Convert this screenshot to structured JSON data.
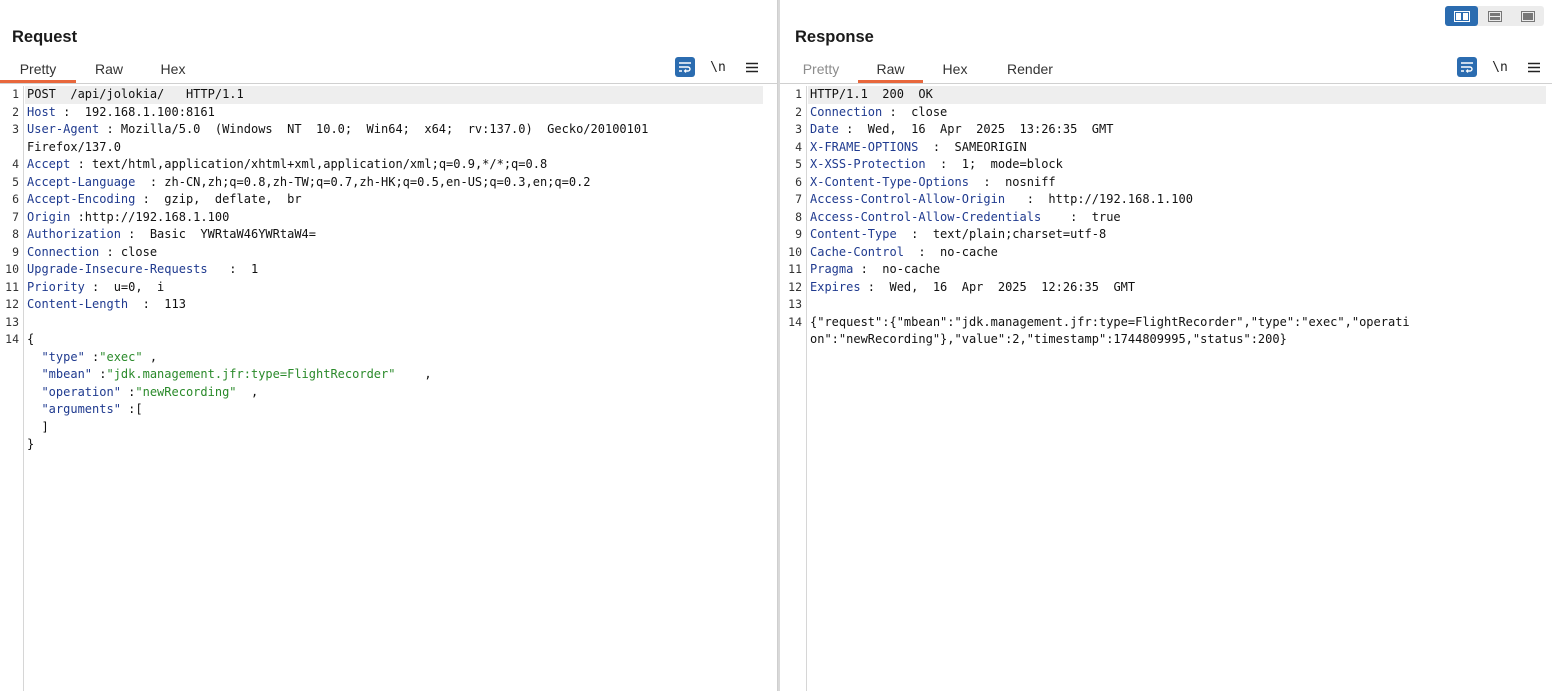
{
  "request": {
    "title": "Request",
    "tabs": [
      {
        "label": "Pretty",
        "active": true
      },
      {
        "label": "Raw",
        "active": false
      },
      {
        "label": "Hex",
        "active": false
      }
    ],
    "toolbar": {
      "wrap_icon": "wrap-lines-icon",
      "newline_label": "\\n",
      "menu_icon": "hamburger-menu-icon"
    },
    "lines": [
      {
        "n": "1",
        "k": "",
        "v": "POST  /api/jolokia/   HTTP/1.1"
      },
      {
        "n": "2",
        "k": "Host",
        "v": " :  192.168.1.100:8161"
      },
      {
        "n": "3",
        "k": "User-Agent",
        "v": " : Mozilla/5.0  (Windows  NT  10.0;  Win64;  x64;  rv:137.0)  Gecko/20100101"
      },
      {
        "n": "",
        "k": "",
        "v": "Firefox/137.0"
      },
      {
        "n": "4",
        "k": "Accept",
        "v": " : text/html,application/xhtml+xml,application/xml;q=0.9,*/*;q=0.8"
      },
      {
        "n": "5",
        "k": "Accept-Language",
        "v": "  : zh-CN,zh;q=0.8,zh-TW;q=0.7,zh-HK;q=0.5,en-US;q=0.3,en;q=0.2"
      },
      {
        "n": "6",
        "k": "Accept-Encoding",
        "v": " :  gzip,  deflate,  br"
      },
      {
        "n": "7",
        "k": "Origin",
        "v": " :http://192.168.1.100"
      },
      {
        "n": "8",
        "k": "Authorization",
        "v": " :  Basic  YWRtaW46YWRtaW4="
      },
      {
        "n": "9",
        "k": "Connection",
        "v": " : close"
      },
      {
        "n": "10",
        "k": "Upgrade-Insecure-Requests",
        "v": "   :  1"
      },
      {
        "n": "11",
        "k": "Priority",
        "v": " :  u=0,  i"
      },
      {
        "n": "12",
        "k": "Content-Length",
        "v": "  :  113"
      },
      {
        "n": "13",
        "k": "",
        "v": ""
      },
      {
        "n": "14",
        "k": "",
        "v": "{"
      },
      {
        "n": "",
        "k": "  \"type\"",
        "v": " :",
        "s": "\"exec\"",
        "t": " ,"
      },
      {
        "n": "",
        "k": "  \"mbean\"",
        "v": " :",
        "s": "\"jdk.management.jfr:type=FlightRecorder\"",
        "t": "    ,"
      },
      {
        "n": "",
        "k": "  \"operation\"",
        "v": " :",
        "s": "\"newRecording\"",
        "t": "  ,"
      },
      {
        "n": "",
        "k": "  \"arguments\"",
        "v": " :["
      },
      {
        "n": "",
        "k": "",
        "v": "  ]"
      },
      {
        "n": "",
        "k": "",
        "v": "}"
      }
    ]
  },
  "response": {
    "title": "Response",
    "tabs": [
      {
        "label": "Pretty",
        "active": false
      },
      {
        "label": "Raw",
        "active": true
      },
      {
        "label": "Hex",
        "active": false
      },
      {
        "label": "Render",
        "active": false
      }
    ],
    "toolbar": {
      "wrap_icon": "wrap-lines-icon",
      "newline_label": "\\n",
      "menu_icon": "hamburger-menu-icon"
    },
    "lines": [
      {
        "n": "1",
        "k": "",
        "v": "HTTP/1.1  200  OK"
      },
      {
        "n": "2",
        "k": "Connection",
        "v": " :  close"
      },
      {
        "n": "3",
        "k": "Date",
        "v": " :  Wed,  16  Apr  2025  13:26:35  GMT"
      },
      {
        "n": "4",
        "k": "X-FRAME-OPTIONS",
        "v": "  :  SAMEORIGIN"
      },
      {
        "n": "5",
        "k": "X-XSS-Protection",
        "v": "  :  1;  mode=block"
      },
      {
        "n": "6",
        "k": "X-Content-Type-Options",
        "v": "  :  nosniff"
      },
      {
        "n": "7",
        "k": "Access-Control-Allow-Origin",
        "v": "   :  http://192.168.1.100"
      },
      {
        "n": "8",
        "k": "Access-Control-Allow-Credentials",
        "v": "    :  true"
      },
      {
        "n": "9",
        "k": "Content-Type",
        "v": "  :  text/plain;charset=utf-8"
      },
      {
        "n": "10",
        "k": "Cache-Control",
        "v": "  :  no-cache"
      },
      {
        "n": "11",
        "k": "Pragma",
        "v": " :  no-cache"
      },
      {
        "n": "12",
        "k": "Expires",
        "v": " :  Wed,  16  Apr  2025  12:26:35  GMT"
      },
      {
        "n": "13",
        "k": "",
        "v": ""
      },
      {
        "n": "14",
        "k": "",
        "v": "{\"request\":{\"mbean\":\"jdk.management.jfr:type=FlightRecorder\",\"type\":\"exec\",\"operati"
      },
      {
        "n": "",
        "k": "",
        "v": "on\":\"newRecording\"},\"value\":2,\"timestamp\":1744809995,\"status\":200}"
      }
    ]
  },
  "view_switch": {
    "buttons": [
      {
        "icon": "split-horizontal-view-icon",
        "active": true
      },
      {
        "icon": "split-vertical-view-icon",
        "active": false
      },
      {
        "icon": "single-panel-view-icon",
        "active": false
      }
    ]
  }
}
